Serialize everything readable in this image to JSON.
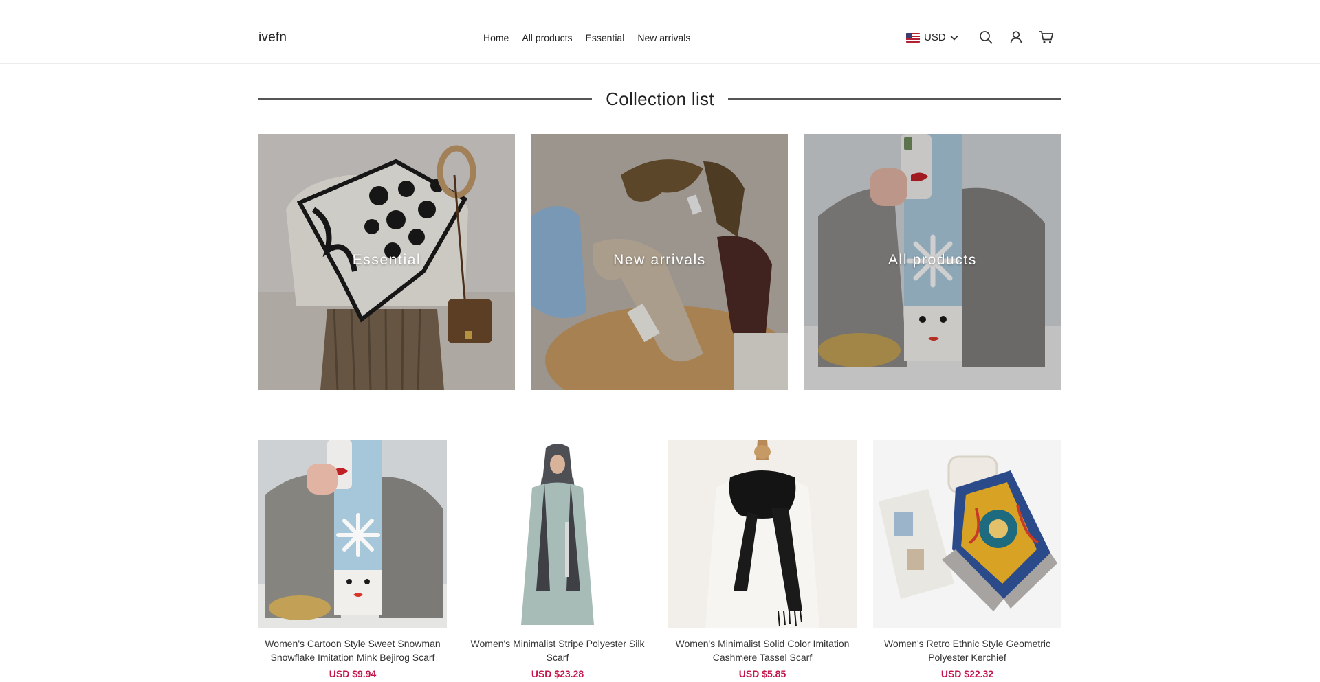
{
  "brand": {
    "name": "ivefn"
  },
  "nav": {
    "items": [
      {
        "label": "Home"
      },
      {
        "label": "All products"
      },
      {
        "label": "Essential"
      },
      {
        "label": "New arrivals"
      }
    ]
  },
  "currency": {
    "code": "USD",
    "flag_icon": "us-flag-icon"
  },
  "header_icons": [
    "search-icon",
    "user-icon",
    "cart-icon"
  ],
  "collection_section": {
    "title": "Collection list",
    "cards": [
      {
        "label": "Essential"
      },
      {
        "label": "New arrivals"
      },
      {
        "label": "All products"
      }
    ]
  },
  "products": [
    {
      "title": "Women's Cartoon Style Sweet Snowman Snowflake Imitation Mink Bejirog Scarf",
      "price": "USD $9.94"
    },
    {
      "title": "Women's Minimalist Stripe Polyester Silk Scarf",
      "price": "USD $23.28"
    },
    {
      "title": "Women's Minimalist Solid Color Imitation Cashmere Tassel Scarf",
      "price": "USD $5.85"
    },
    {
      "title": "Women's Retro Ethnic Style Geometric Polyester Kerchief",
      "price": "USD $22.32"
    }
  ],
  "colors": {
    "price": "#c4164b",
    "text": "#222222",
    "border": "#ececec"
  }
}
